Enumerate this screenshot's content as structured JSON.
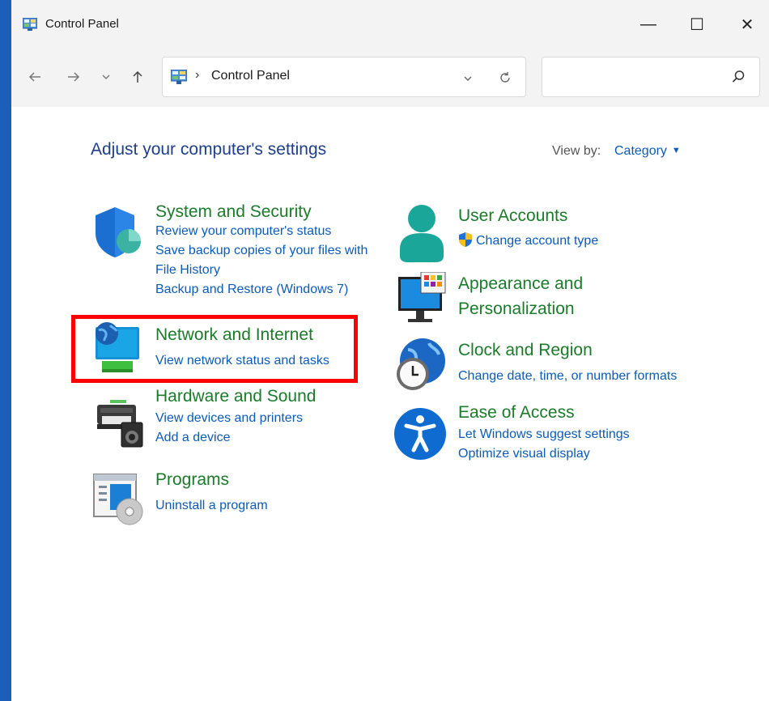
{
  "window": {
    "title": "Control Panel",
    "controls": {
      "minimize": "—",
      "maximize": "☐",
      "close": "✕"
    }
  },
  "nav": {
    "back_icon": "arrow-left-icon",
    "forward_icon": "arrow-right-icon",
    "recent_icon": "chevron-down-icon",
    "up_icon": "arrow-up-icon",
    "address": {
      "separator": "›",
      "crumb": "Control Panel"
    },
    "search": {
      "placeholder": "",
      "value": ""
    }
  },
  "content": {
    "heading": "Adjust your computer's settings",
    "view_by_label": "View by:",
    "view_by_value": "Category"
  },
  "categories_left": [
    {
      "title": "System and Security",
      "icon": "shield-icon",
      "links": [
        "Review your computer's status",
        "Save backup copies of your files with",
        "File History",
        "Backup and Restore (Windows 7)"
      ]
    },
    {
      "title": "Network and Internet",
      "icon": "globe-monitor-icon",
      "links": [
        "View network status and tasks"
      ]
    },
    {
      "title": "Hardware and Sound",
      "icon": "printer-speaker-icon",
      "links": [
        "View devices and printers",
        "Add a device"
      ]
    },
    {
      "title": "Programs",
      "icon": "programs-disc-icon",
      "links": [
        "Uninstall a program"
      ]
    }
  ],
  "categories_right": [
    {
      "title": "User Accounts",
      "icon": "user-icon",
      "links": [
        "Change account type"
      ]
    },
    {
      "title_line1": "Appearance and",
      "title_line2": "Personalization",
      "icon": "monitor-palette-icon",
      "links": []
    },
    {
      "title": "Clock and Region",
      "icon": "clock-globe-icon",
      "links": [
        "Change date, time, or number formats"
      ]
    },
    {
      "title": "Ease of Access",
      "icon": "accessibility-icon",
      "links": [
        "Let Windows suggest settings",
        "Optimize visual display"
      ]
    }
  ],
  "colors": {
    "category_title": "#1b7b2a",
    "link": "#0b5cb8",
    "heading": "#1e3f8a",
    "highlight": "#ff0000"
  }
}
